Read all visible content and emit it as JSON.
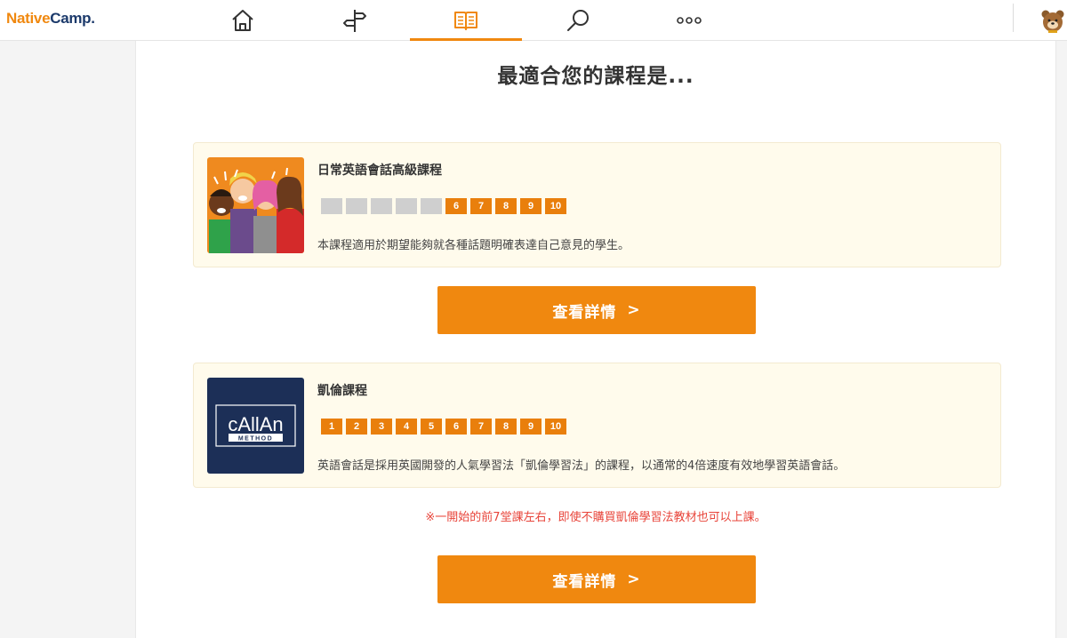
{
  "header": {
    "logo_part1": "Native",
    "logo_part2": "Camp.",
    "nav": [
      {
        "icon": "home-icon"
      },
      {
        "icon": "signpost-icon"
      },
      {
        "icon": "book-icon",
        "active": true
      },
      {
        "icon": "search-icon"
      },
      {
        "icon": "more-icon"
      }
    ],
    "avatar": "bear-avatar-icon"
  },
  "main": {
    "title": "最適合您的課程是...",
    "courses": [
      {
        "title": "日常英語會話高級課程",
        "levels": [
          "",
          "",
          "",
          "",
          "",
          "6",
          "7",
          "8",
          "9",
          "10"
        ],
        "description": "本課程適用於期望能夠就各種話題明確表達自己意見的學生。",
        "image": "people-talking-illustration",
        "button_label": "查看詳情",
        "button_chevron": ">"
      },
      {
        "title": "凱倫課程",
        "levels": [
          "1",
          "2",
          "3",
          "4",
          "5",
          "6",
          "7",
          "8",
          "9",
          "10"
        ],
        "description": "英語會話是採用英國開發的人氣學習法「凱倫學習法」的課程，以通常的4倍速度有效地學習英語會話。",
        "image": "callan-method-logo",
        "logo_text": "cAllAn",
        "logo_sub": "METHOD",
        "notice": "※一開始的前7堂課左右，即使不購買凱倫學習法教材也可以上課。",
        "button_label": "查看詳情",
        "button_chevron": ">"
      }
    ]
  },
  "colors": {
    "accent": "#f0880f",
    "level_on": "#e97f0c",
    "level_off": "#cfcfcf",
    "card_bg": "#fffbec",
    "notice": "#e8443a",
    "callan_bg": "#1c2f57"
  }
}
